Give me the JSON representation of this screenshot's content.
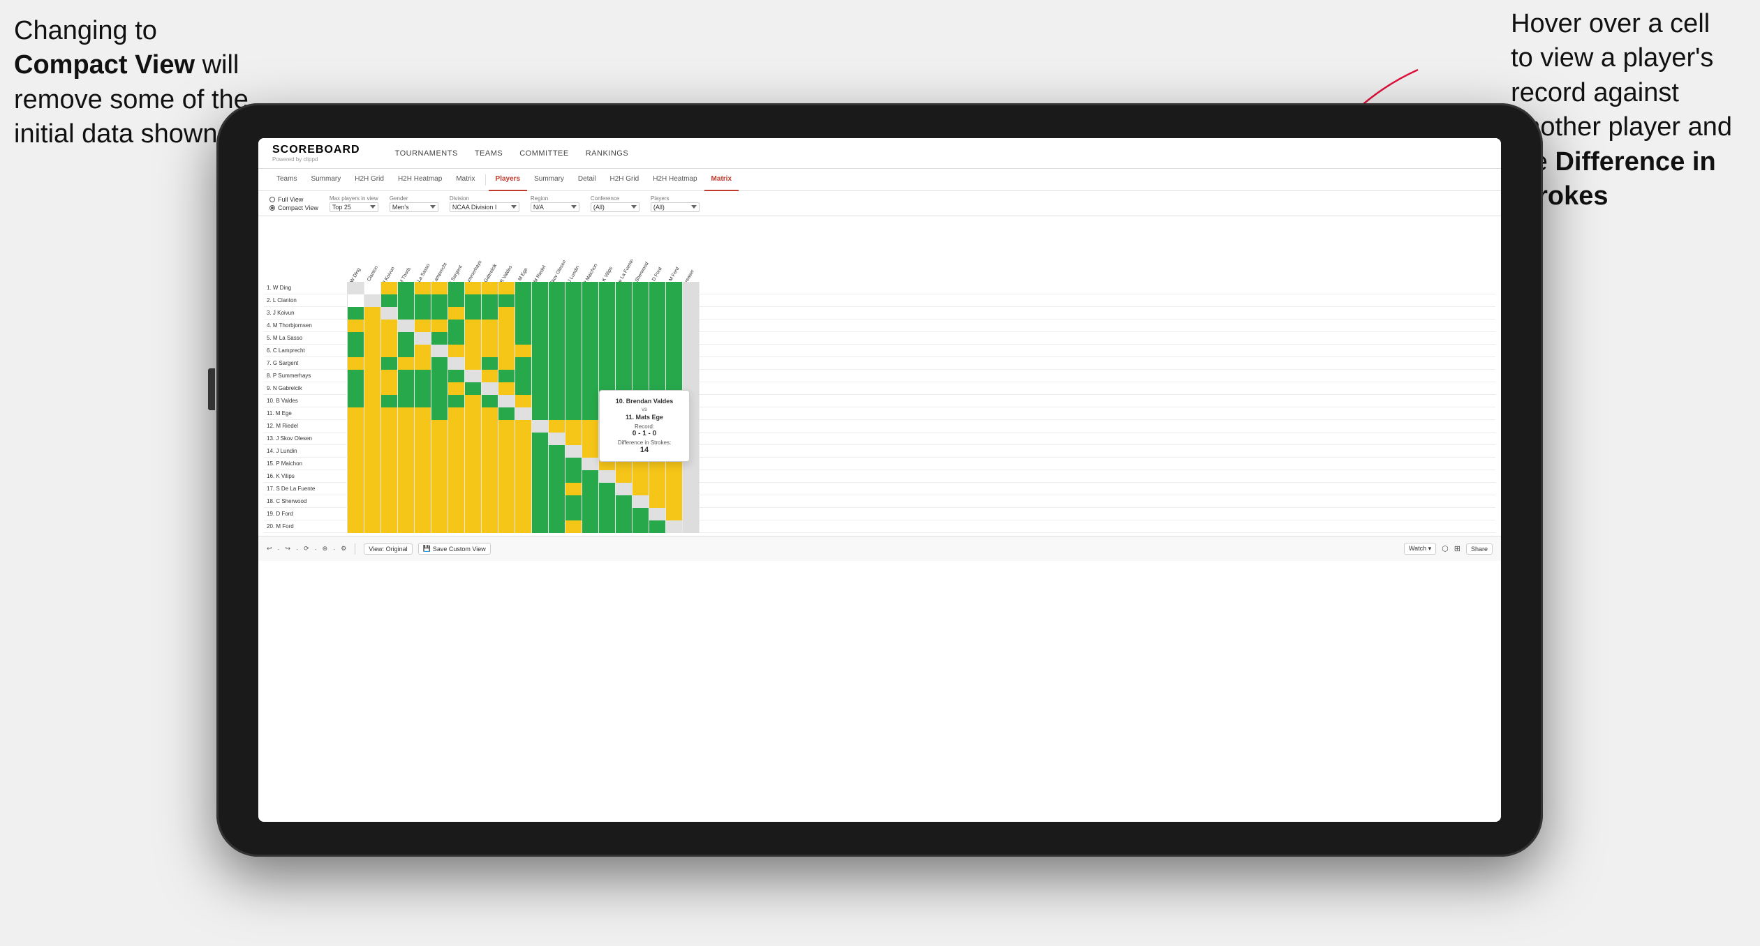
{
  "annotation_left": {
    "line1": "Changing to",
    "line2_bold": "Compact View",
    "line2_rest": " will",
    "line3": "remove some of the",
    "line4": "initial data shown"
  },
  "annotation_right": {
    "line1": "Hover over a cell",
    "line2": "to view a player's",
    "line3": "record against",
    "line4": "another player and",
    "line5_pre": "the ",
    "line5_bold": "Difference in",
    "line6_bold": "Strokes"
  },
  "nav": {
    "brand": "SCOREBOARD",
    "powered": "Powered by clippd",
    "items": [
      "TOURNAMENTS",
      "TEAMS",
      "COMMITTEE",
      "RANKINGS"
    ]
  },
  "sub_tabs": {
    "section1": [
      "Teams",
      "Summary",
      "H2H Grid",
      "H2H Heatmap",
      "Matrix"
    ],
    "section2": [
      "Players",
      "Summary",
      "Detail",
      "H2H Grid",
      "H2H Heatmap",
      "Matrix"
    ],
    "active": "Matrix"
  },
  "filters": {
    "view_full": "Full View",
    "view_compact": "Compact View",
    "selected_view": "compact",
    "max_players_label": "Max players in view",
    "max_players_value": "Top 25",
    "gender_label": "Gender",
    "gender_value": "Men's",
    "division_label": "Division",
    "division_value": "NCAA Division I",
    "region_label": "Region",
    "region_value": "N/A",
    "conference_label": "Conference",
    "conference_value": "(All)",
    "players_label": "Players",
    "players_value": "(All)"
  },
  "players": [
    "1. W Ding",
    "2. L Clanton",
    "3. J Koivun",
    "4. M Thorbjornsen",
    "5. M La Sasso",
    "6. C Lamprecht",
    "7. G Sargent",
    "8. P Summerhays",
    "9. N Gabrelcik",
    "10. B Valdes",
    "11. M Ege",
    "12. M Riedel",
    "13. J Skov Olesen",
    "14. J Lundin",
    "15. P Maichon",
    "16. K Vilips",
    "17. S De La Fuente",
    "18. C Sherwood",
    "19. D Ford",
    "20. M Ford"
  ],
  "col_headers": [
    "1. W Ding",
    "2. L Clanton",
    "3. J Koivun",
    "4. M Thorb.",
    "5. M La Sasso",
    "6. C Lamprecht",
    "7. G Sargent",
    "8. P Summerhays",
    "9. N Gabrelcik",
    "10. B Valdes",
    "11. M Ege",
    "12. M Riedel",
    "13. J Skov Olesen",
    "14. J Lundin",
    "15. P Maichon",
    "16. K Vilips",
    "17. S De La Fuente",
    "18. C Sherwood",
    "19. D Ford",
    "20. M Ferd",
    "Greaser"
  ],
  "tooltip": {
    "player1": "10. Brendan Valdes",
    "vs": "vs",
    "player2": "11. Mats Ege",
    "record_label": "Record:",
    "record_value": "0 - 1 - 0",
    "diff_label": "Difference in Strokes:",
    "diff_value": "14"
  },
  "toolbar": {
    "undo": "↩",
    "redo": "↪",
    "view_original": "View: Original",
    "save_custom": "Save Custom View",
    "watch": "Watch ▾",
    "share": "Share"
  }
}
